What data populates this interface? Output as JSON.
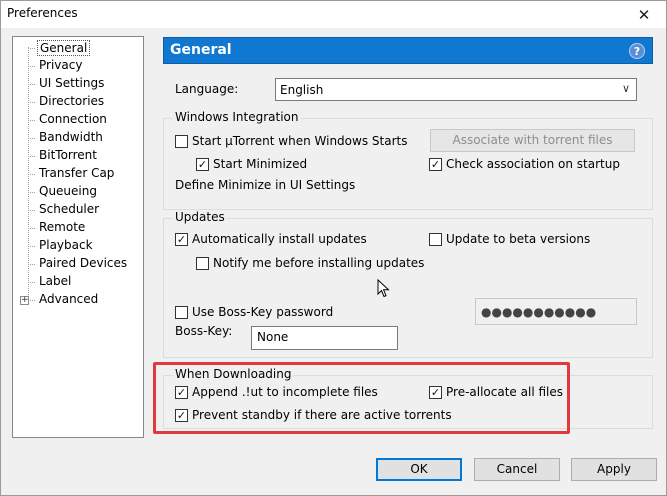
{
  "window": {
    "title": "Preferences",
    "close_glyph": "✕"
  },
  "tree": {
    "items": [
      {
        "label": "General",
        "selected": true
      },
      {
        "label": "Privacy"
      },
      {
        "label": "UI Settings"
      },
      {
        "label": "Directories"
      },
      {
        "label": "Connection"
      },
      {
        "label": "Bandwidth"
      },
      {
        "label": "BitTorrent"
      },
      {
        "label": "Transfer Cap"
      },
      {
        "label": "Queueing"
      },
      {
        "label": "Scheduler"
      },
      {
        "label": "Remote"
      },
      {
        "label": "Playback"
      },
      {
        "label": "Paired Devices"
      },
      {
        "label": "Label"
      },
      {
        "label": "Advanced",
        "expandable": true
      }
    ],
    "expander_glyph": "+"
  },
  "header": {
    "title": "General",
    "help_glyph": "?"
  },
  "language": {
    "label": "Language:",
    "value": "English",
    "arrow": "∨"
  },
  "windows_integration": {
    "title": "Windows Integration",
    "start_with_windows": {
      "label": "Start µTorrent when Windows Starts",
      "checked": false
    },
    "start_minimized": {
      "label": "Start Minimized",
      "checked": true
    },
    "define_minimize": "Define Minimize in UI Settings",
    "associate_button": "Associate with torrent files",
    "check_association": {
      "label": "Check association on startup",
      "checked": true
    }
  },
  "updates": {
    "title": "Updates",
    "auto_install": {
      "label": "Automatically install updates",
      "checked": true
    },
    "beta": {
      "label": "Update to beta versions",
      "checked": false
    },
    "notify": {
      "label": "Notify me before installing updates",
      "checked": false
    }
  },
  "boss_key": {
    "use_password": {
      "label": "Use Boss-Key password",
      "checked": false
    },
    "password_value": "●●●●●●●●●●●",
    "label": "Boss-Key:",
    "value": "None"
  },
  "when_downloading": {
    "title": "When Downloading",
    "append_ut": {
      "label": "Append .!ut to incomplete files",
      "checked": true
    },
    "preallocate": {
      "label": "Pre-allocate all files",
      "checked": true
    },
    "prevent_standby": {
      "label": "Prevent standby if there are active torrents",
      "checked": true
    }
  },
  "buttons": {
    "ok": "OK",
    "cancel": "Cancel",
    "apply": "Apply"
  },
  "check_glyph": "✓",
  "colors": {
    "header": "#1078d0",
    "highlight": "#e0393e"
  }
}
